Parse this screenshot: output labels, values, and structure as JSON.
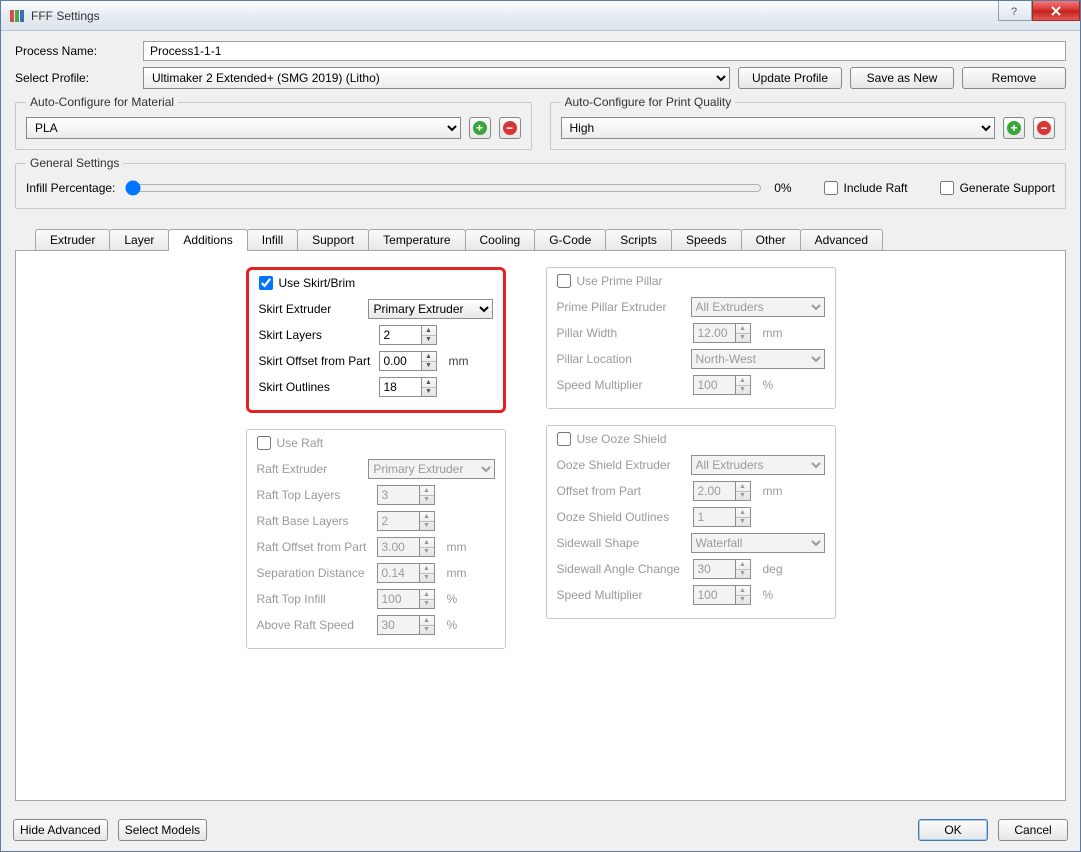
{
  "window": {
    "title": "FFF Settings"
  },
  "form": {
    "process_name_label": "Process Name:",
    "process_name": "Process1-1-1",
    "select_profile_label": "Select Profile:",
    "profile": "Ultimaker 2 Extended+ (SMG 2019) (Litho)",
    "buttons": {
      "update": "Update Profile",
      "save_as_new": "Save as New",
      "remove": "Remove"
    }
  },
  "autoconf": {
    "material_legend": "Auto-Configure for Material",
    "material_value": "PLA",
    "quality_legend": "Auto-Configure for Print Quality",
    "quality_value": "High"
  },
  "general": {
    "legend": "General Settings",
    "infill_label": "Infill Percentage:",
    "infill_value_text": "0%",
    "include_raft": "Include Raft",
    "generate_support": "Generate Support"
  },
  "tabs": [
    "Extruder",
    "Layer",
    "Additions",
    "Infill",
    "Support",
    "Temperature",
    "Cooling",
    "G-Code",
    "Scripts",
    "Speeds",
    "Other",
    "Advanced"
  ],
  "active_tab": "Additions",
  "skirt": {
    "checkbox": "Use Skirt/Brim",
    "extruder_label": "Skirt Extruder",
    "extruder_value": "Primary Extruder",
    "layers_label": "Skirt Layers",
    "layers_value": "2",
    "offset_label": "Skirt Offset from Part",
    "offset_value": "0.00",
    "offset_unit": "mm",
    "outlines_label": "Skirt Outlines",
    "outlines_value": "18"
  },
  "raft": {
    "checkbox": "Use Raft",
    "extruder_label": "Raft Extruder",
    "extruder_value": "Primary Extruder",
    "top_layers_label": "Raft Top Layers",
    "top_layers_value": "3",
    "base_layers_label": "Raft Base Layers",
    "base_layers_value": "2",
    "offset_label": "Raft Offset from Part",
    "offset_value": "3.00",
    "offset_unit": "mm",
    "sep_label": "Separation Distance",
    "sep_value": "0.14",
    "sep_unit": "mm",
    "top_infill_label": "Raft Top Infill",
    "top_infill_value": "100",
    "top_infill_unit": "%",
    "above_speed_label": "Above Raft Speed",
    "above_speed_value": "30",
    "above_speed_unit": "%"
  },
  "pillar": {
    "checkbox": "Use Prime Pillar",
    "extruder_label": "Prime Pillar Extruder",
    "extruder_value": "All Extruders",
    "width_label": "Pillar Width",
    "width_value": "12.00",
    "width_unit": "mm",
    "location_label": "Pillar Location",
    "location_value": "North-West",
    "speed_label": "Speed Multiplier",
    "speed_value": "100",
    "speed_unit": "%"
  },
  "ooze": {
    "checkbox": "Use Ooze Shield",
    "extruder_label": "Ooze Shield Extruder",
    "extruder_value": "All Extruders",
    "offset_label": "Offset from Part",
    "offset_value": "2.00",
    "offset_unit": "mm",
    "outlines_label": "Ooze Shield Outlines",
    "outlines_value": "1",
    "shape_label": "Sidewall Shape",
    "shape_value": "Waterfall",
    "angle_label": "Sidewall Angle Change",
    "angle_value": "30",
    "angle_unit": "deg",
    "speed_label": "Speed Multiplier",
    "speed_value": "100",
    "speed_unit": "%"
  },
  "bottom": {
    "hide_advanced": "Hide Advanced",
    "select_models": "Select Models",
    "ok": "OK",
    "cancel": "Cancel"
  }
}
